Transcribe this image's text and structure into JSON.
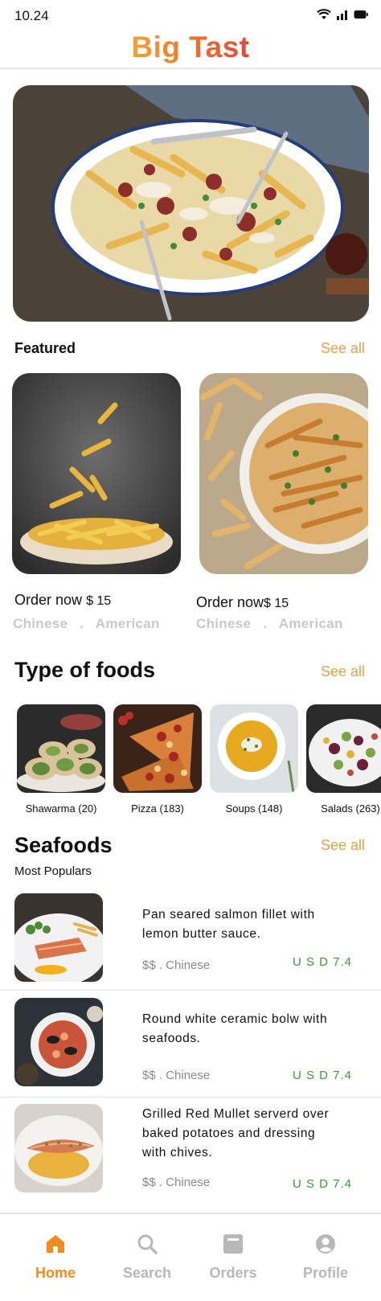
{
  "status": {
    "time": "10.24",
    "icons": [
      "wifi-icon",
      "signal-icon",
      "battery-icon"
    ]
  },
  "header": {
    "title": "Big Tast"
  },
  "hero": {
    "image": "loaded-fries-hero"
  },
  "featured": {
    "title": "Featured",
    "see_all": "See all",
    "items": [
      {
        "order": "Order now",
        "price": "$ 15",
        "cuisine_a": "Chinese",
        "sep": ".",
        "cuisine_b": "American"
      },
      {
        "order": "Order now",
        "price": "$ 15",
        "cuisine_a": "Chinese",
        "sep": ".",
        "cuisine_b": "American"
      }
    ]
  },
  "types": {
    "title": "Type of foods",
    "see_all": "See all",
    "items": [
      {
        "label": "Shawarma (20)"
      },
      {
        "label": "Pizza (183)"
      },
      {
        "label": "Soups (148)"
      },
      {
        "label": "Salads (263)"
      }
    ]
  },
  "seafoods": {
    "title": "Seafoods",
    "see_all": "See all",
    "subtitle": "Most Populars",
    "items": [
      {
        "line1": "Pan seared salmon fillet with",
        "line2": "lemon butter sauce.",
        "line3": "",
        "meta": "$$ . Chinese",
        "price": "U S D 7.4"
      },
      {
        "line1": "Round white ceramic bolw with",
        "line2": "seafoods.",
        "line3": "",
        "meta": "$$ . Chinese",
        "price": "U S D 7.4"
      },
      {
        "line1": "Grilled Red Mullet serverd over",
        "line2": "baked potatoes and dressing",
        "line3": "with chives.",
        "meta": "$$ . Chinese",
        "price": "U S D 7.4"
      }
    ]
  },
  "nav": {
    "active_color": "#f28c1e",
    "inactive_color": "#b8b8b8",
    "items": [
      {
        "label": "Home",
        "icon": "home-icon"
      },
      {
        "label": "Search",
        "icon": "search-icon"
      },
      {
        "label": "Orders",
        "icon": "orders-icon"
      },
      {
        "label": "Profile",
        "icon": "profile-icon"
      }
    ]
  },
  "colors": {
    "accent": "#f0a042",
    "price_green": "#3f9a3c",
    "muted": "#c9c9c9"
  }
}
